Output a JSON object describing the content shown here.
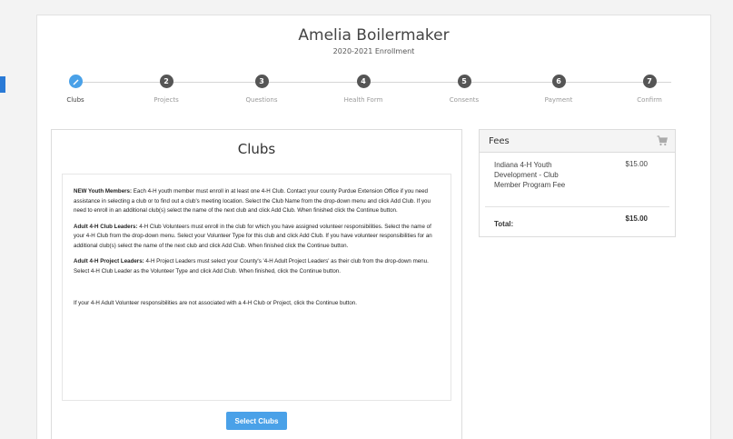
{
  "header": {
    "name": "Amelia Boilermaker",
    "subtitle": "2020-2021 Enrollment"
  },
  "steps": [
    {
      "num": "",
      "label": "Clubs",
      "active": true
    },
    {
      "num": "2",
      "label": "Projects"
    },
    {
      "num": "3",
      "label": "Questions"
    },
    {
      "num": "4",
      "label": "Health Form"
    },
    {
      "num": "5",
      "label": "Consents"
    },
    {
      "num": "6",
      "label": "Payment"
    },
    {
      "num": "7",
      "label": "Confirm"
    }
  ],
  "clubs": {
    "title": "Clubs",
    "p1_bold": "NEW Youth Members:",
    "p1_text": "  Each 4-H youth member must enroll in at least one 4-H Club.  Contact your county Purdue Extension Office if you need assistance in selecting a club or to find out a club's meeting location.  Select the Club Name from the drop-down menu and click Add Club.  If you need to enroll in an additional club(s) select the name of the next club and click Add Club. When finished click the Continue button.",
    "p2_bold": "Adult 4-H Club Leaders:",
    "p2_text": "  4-H Club Volunteers must enroll in the club for which you have assigned volunteer responsibilities. Select the name of your 4-H Club from the drop-down menu.  Select your Volunteer Type for this club and click Add Club.  If you have volunteer responsibilities for an additional club(s) select the name of the next club and click Add Club. When finished click the Continue button.",
    "p3_bold": "Adult 4-H Project Leaders:",
    "p3_text": "  4-H Project Leaders must select your County's '4-H Adult Project Leaders' as their club from the drop-down menu.  Select 4-H Club Leader as the Volunteer Type and click Add Club.  When finished, click the Continue button.",
    "p4_text": "If your 4-H Adult Volunteer responsibilities are not associated with a 4-H Club or Project, click the Continue button.",
    "button_label": "Select Clubs"
  },
  "fees": {
    "title": "Fees",
    "items": [
      {
        "desc": "Indiana 4-H Youth Development - Club Member Program Fee",
        "amount": "$15.00"
      }
    ],
    "total_label": "Total:",
    "total_amount": "$15.00"
  },
  "colors": {
    "accent": "#4aa1e8",
    "step_inactive": "#555555"
  }
}
